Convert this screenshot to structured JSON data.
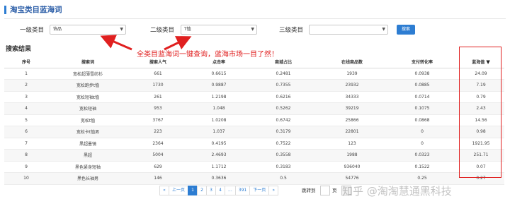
{
  "header": {
    "title": "淘宝类目蓝海词"
  },
  "filters": {
    "level1_label": "一级类目",
    "level1_value": "饰品",
    "level2_label": "二级类目",
    "level2_value": "T恤",
    "level3_label": "三级类目",
    "level3_value": "",
    "search_button": "搜索"
  },
  "results": {
    "title": "搜索结果",
    "columns": [
      "序号",
      "搜索词",
      "搜索人气",
      "点击率",
      "商城占比",
      "在线商品数",
      "支付转化率",
      "蓝海值"
    ],
    "rows": [
      [
        "1",
        "宽松超薄雪纺衫",
        "661",
        "0.6615",
        "0.2481",
        "1939",
        "0.0938",
        "24.09"
      ],
      [
        "2",
        "宽松跑步t恤",
        "1730",
        "0.9887",
        "0.7355",
        "23932",
        "0.0885",
        "7.19"
      ],
      [
        "3",
        "宽松短袖t恤",
        "261",
        "1.2198",
        "0.6216",
        "34333",
        "0.0714",
        "0.79"
      ],
      [
        "4",
        "宽松短袖",
        "953",
        "1.048",
        "0.5262",
        "39219",
        "0.1075",
        "2.43"
      ],
      [
        "5",
        "宽松t恤",
        "3767",
        "1.0208",
        "0.6742",
        "25866",
        "0.0868",
        "14.56"
      ],
      [
        "6",
        "宽松卡t恤男",
        "223",
        "1.037",
        "0.3179",
        "22801",
        "0",
        "0.98"
      ],
      [
        "7",
        "黑超墨镜",
        "2364",
        "0.4195",
        "0.7522",
        "123",
        "0",
        "1921.95"
      ],
      [
        "8",
        "黑超",
        "5004",
        "2.4693",
        "0.3558",
        "1988",
        "0.0323",
        "251.71"
      ],
      [
        "9",
        "黑色紧身短袖",
        "629",
        "1.1712",
        "0.3183",
        "936040",
        "0.1522",
        "0.07"
      ],
      [
        "10",
        "黑色长袖男",
        "146",
        "0.3636",
        "0.5",
        "54776",
        "0.25",
        "0.27"
      ]
    ]
  },
  "annotation": {
    "text": "全类目蓝海词一键查询，蓝海市场一目了然！"
  },
  "pagination": {
    "prev_first": "«",
    "prev": "上一页",
    "pages": [
      "1",
      "2",
      "3",
      "4"
    ],
    "ellipsis": "...",
    "last_page": "391",
    "next": "下一页",
    "next_last": "»",
    "jump_label": "跳转到",
    "jump_unit": "页"
  },
  "watermark": {
    "text": "知乎 @淘淘慧通黑科技"
  },
  "colors": {
    "accent": "#2d7dd2",
    "annotation_red": "#e02020"
  }
}
